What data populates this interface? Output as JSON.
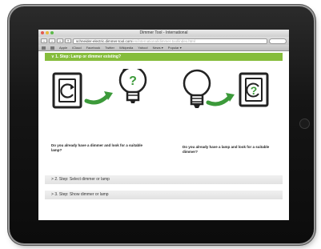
{
  "browser": {
    "window_title": "Dimmer Tool - International",
    "url_main": "schneider-electric.dimmer-tool.com",
    "url_faded": "/en/international/dimmer-tool/index.html",
    "bookmarks": [
      "Apple",
      "iCloud",
      "Facebook",
      "Twitter",
      "Wikipedia",
      "Yahoo!",
      "News ▾",
      "Popular ▾"
    ]
  },
  "page": {
    "step1_label": "1. Step: Lamp or dimmer existing?",
    "option_dimmer_caption": "Do you already have a dimmer and look for a suitable lamp?",
    "option_lamp_caption": "Do you already have a lamp and look for a suitable dimmer?",
    "step2_label": "2. Step: Select dimmer or lamp",
    "step3_label": "3. Step: Show dimmer or lamp"
  },
  "colors": {
    "accent": "#86bd3c",
    "tablet": "#151515"
  },
  "icons": [
    "dimmer-icon",
    "arrow-right-icon",
    "bulb-question-icon",
    "bulb-icon",
    "dimmer-question-icon"
  ]
}
